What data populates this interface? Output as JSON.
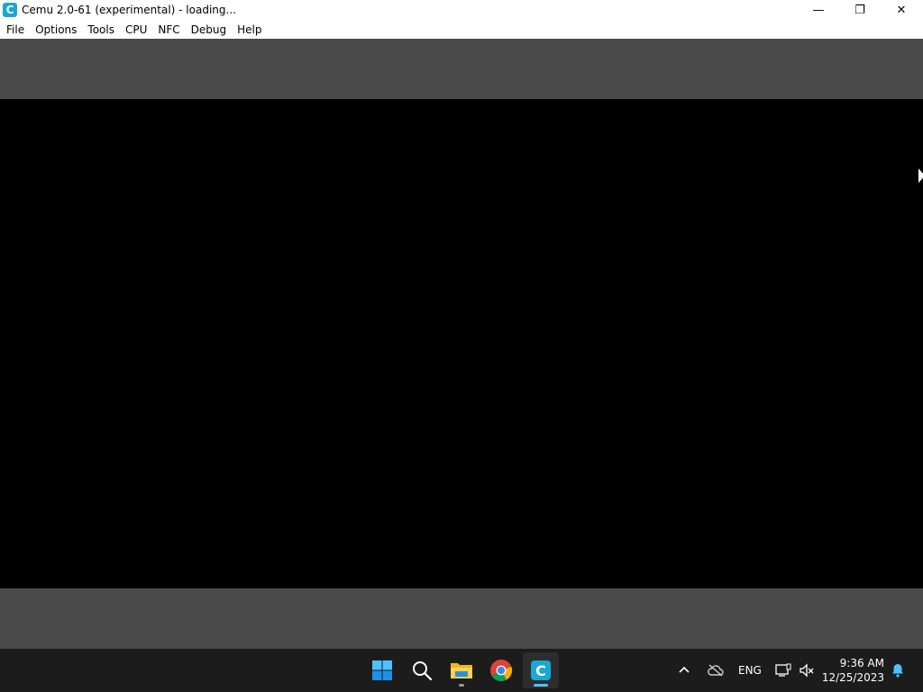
{
  "window": {
    "title": "Cemu 2.0-61 (experimental) - loading...",
    "app_icon_letter": "C",
    "minimize_glyph": "—",
    "maximize_glyph": "❐",
    "close_glyph": "✕"
  },
  "menubar": {
    "items": [
      "File",
      "Options",
      "Tools",
      "CPU",
      "NFC",
      "Debug",
      "Help"
    ]
  },
  "taskbar": {
    "icons": [
      "windows-start-icon",
      "search-icon",
      "file-explorer-icon",
      "chrome-icon",
      "cemu-icon"
    ],
    "tray": {
      "chevron": "^",
      "language": "ENG",
      "time": "9:36 AM",
      "date": "12/25/2023"
    }
  },
  "colors": {
    "render_letterbox": "#4a4a4a",
    "render_area": "#000000",
    "taskbar_bg": "#1c1c1c",
    "cemu_accent": "#1aa7d6"
  }
}
